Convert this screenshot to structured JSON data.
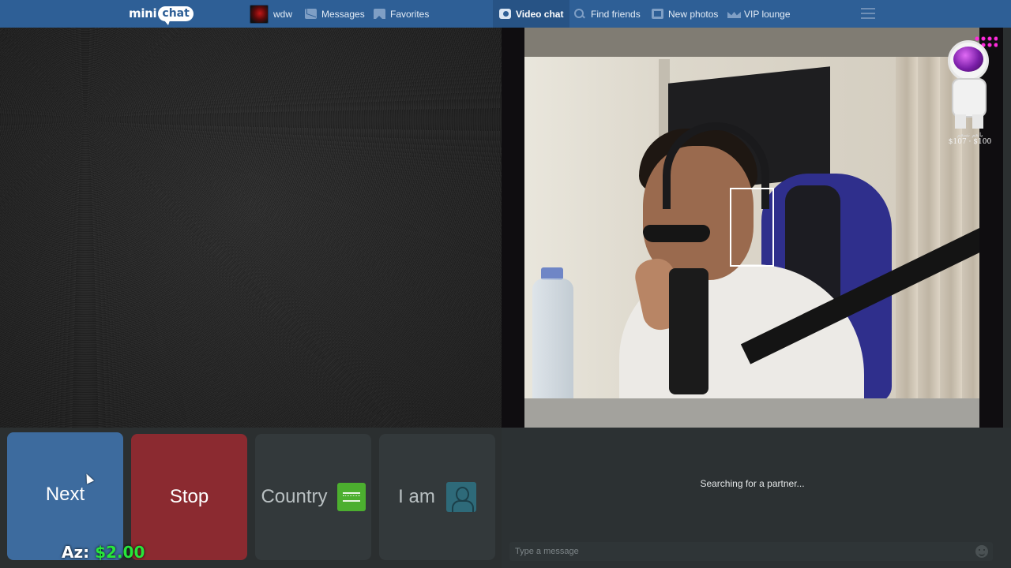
{
  "logo": {
    "part1": "mini",
    "part2": "chat"
  },
  "nav": {
    "user": "wdw",
    "messages": "Messages",
    "favorites": "Favorites",
    "video_chat": "Video chat",
    "find_friends": "Find friends",
    "new_photos": "New photos",
    "vip_lounge": "VIP lounge"
  },
  "icons": {
    "messages": "envelope-icon",
    "favorites": "bookmark-icon",
    "video_chat": "video-camera-icon",
    "find_friends": "search-icon",
    "new_photos": "photo-icon",
    "vip_lounge": "crown-icon",
    "menu": "hamburger-menu-icon",
    "country": "saudi-flag-icon",
    "iam": "person-icon",
    "emoji": "smiley-icon"
  },
  "overlay": {
    "astronaut_caption_top": "يانعم نسعم",
    "astronaut_caption": "$107 · $100",
    "balance_label": "Az:",
    "balance_amount": "$2.00"
  },
  "controls": {
    "next": "Next",
    "stop": "Stop",
    "country": "Country",
    "iam": "I am"
  },
  "chat": {
    "status": "Searching for a partner...",
    "input_placeholder": "Type a message"
  },
  "colors": {
    "nav": "#2e5f96",
    "next": "#3d6b9e",
    "stop": "#8b2a30",
    "tile": "#33393b",
    "balance_amount": "#27e63a"
  }
}
